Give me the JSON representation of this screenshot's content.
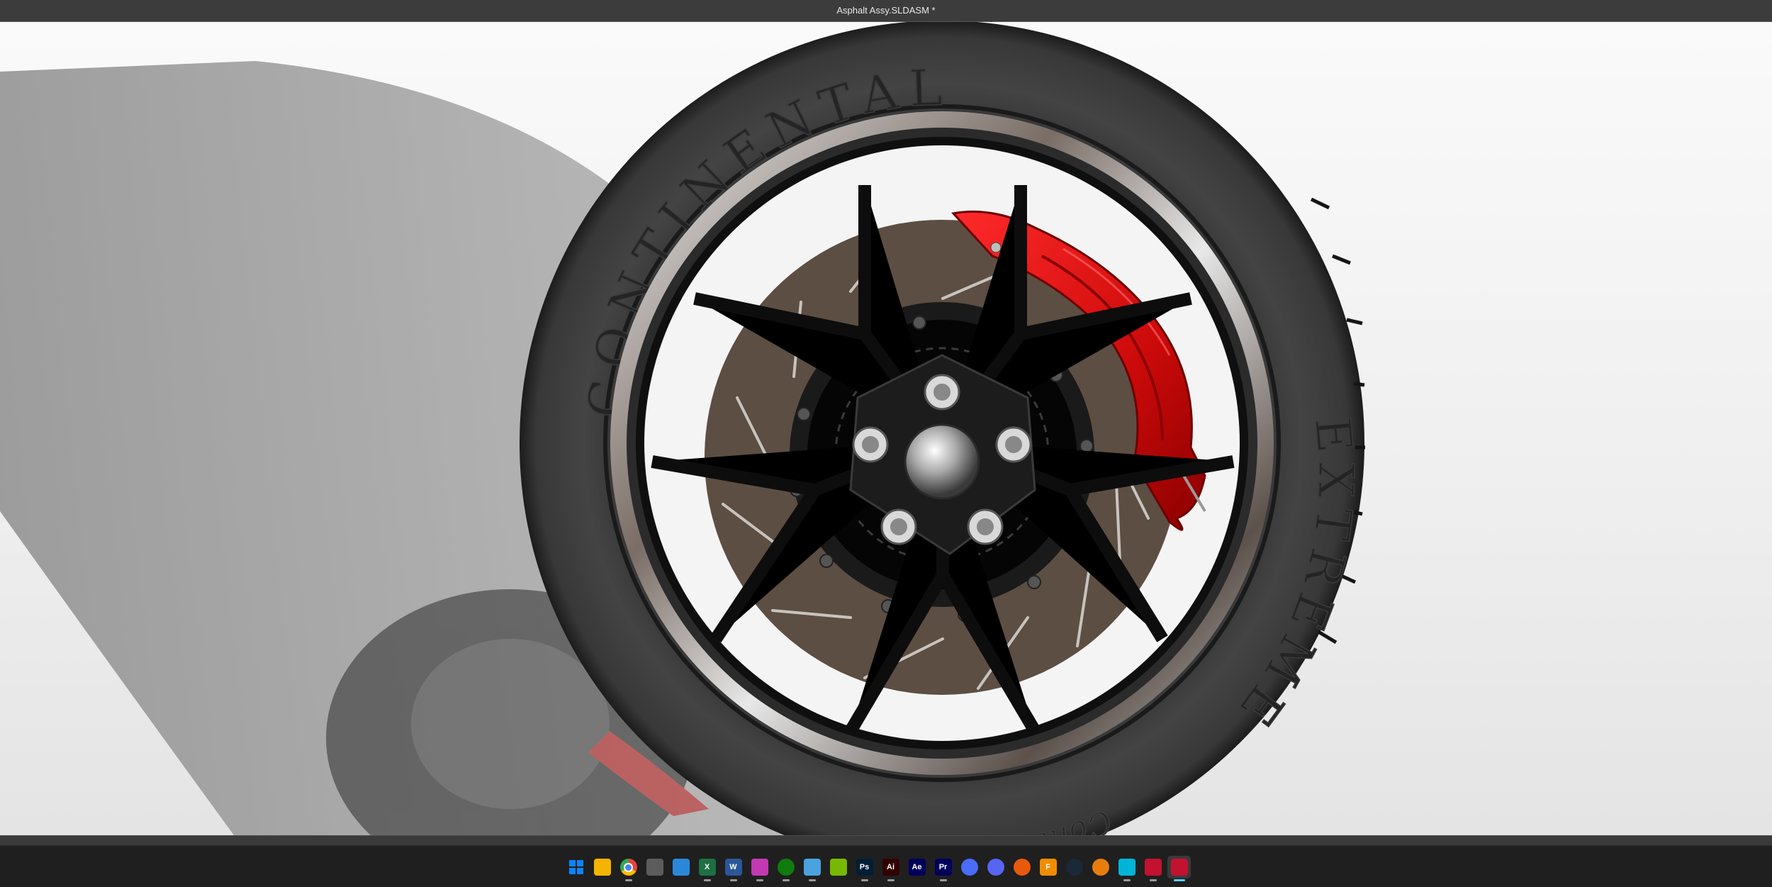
{
  "window": {
    "title": "Asphalt Assy.SLDASM *"
  },
  "tire_text": {
    "brand": "CONTINENTAL",
    "model": "EXTREME",
    "sub": "Contact"
  },
  "heads_up_toolbar": [
    "zoom-to-fit-icon",
    "zoom-to-area-icon",
    "previous-view-icon",
    "section-view-icon",
    "view-orientation-icon",
    "display-style-icon",
    "hide-show-items-icon",
    "edit-appearance-icon",
    "apply-scene-icon",
    "view-settings-icon",
    "viewport-icon"
  ],
  "taskbar": {
    "icons": [
      {
        "name": "start-icon",
        "glyph": "",
        "color": "#0a84ff"
      },
      {
        "name": "file-explorer-icon",
        "glyph": "",
        "color": "#f4b400"
      },
      {
        "name": "chrome-icon",
        "glyph": "",
        "color": "#34a853"
      },
      {
        "name": "calculator-icon",
        "glyph": "",
        "color": "#5c5c5c"
      },
      {
        "name": "microsoft-store-icon",
        "glyph": "",
        "color": "#2b88d8"
      },
      {
        "name": "excel-icon",
        "glyph": "X",
        "color": "#1d7044"
      },
      {
        "name": "word-icon",
        "glyph": "W",
        "color": "#2b579a"
      },
      {
        "name": "photos-icon",
        "glyph": "",
        "color": "#c239b3"
      },
      {
        "name": "xbox-icon",
        "glyph": "",
        "color": "#107c10"
      },
      {
        "name": "notepad-icon",
        "glyph": "",
        "color": "#4aa3df"
      },
      {
        "name": "nvidia-icon",
        "glyph": "",
        "color": "#76b900"
      },
      {
        "name": "photoshop-icon",
        "glyph": "Ps",
        "color": "#001e36"
      },
      {
        "name": "illustrator-icon",
        "glyph": "Ai",
        "color": "#330000"
      },
      {
        "name": "after-effects-icon",
        "glyph": "Ae",
        "color": "#00005b"
      },
      {
        "name": "premiere-icon",
        "glyph": "Pr",
        "color": "#00005b"
      },
      {
        "name": "checkmark-app-icon",
        "glyph": "",
        "color": "#4a6cf7"
      },
      {
        "name": "discord-icon",
        "glyph": "",
        "color": "#5865f2"
      },
      {
        "name": "media-player-icon",
        "glyph": "",
        "color": "#e8590c"
      },
      {
        "name": "fusion-icon",
        "glyph": "F",
        "color": "#f08c00"
      },
      {
        "name": "steam-icon",
        "glyph": "",
        "color": "#1b2838"
      },
      {
        "name": "blender-icon",
        "glyph": "",
        "color": "#e87d0d"
      },
      {
        "name": "3d-app-icon",
        "glyph": "",
        "color": "#00b4d8"
      },
      {
        "name": "solidworks-2026-icon",
        "glyph": "",
        "color": "#c3122f"
      },
      {
        "name": "solidworks-2026-active-icon",
        "glyph": "",
        "color": "#c3122f"
      }
    ]
  }
}
